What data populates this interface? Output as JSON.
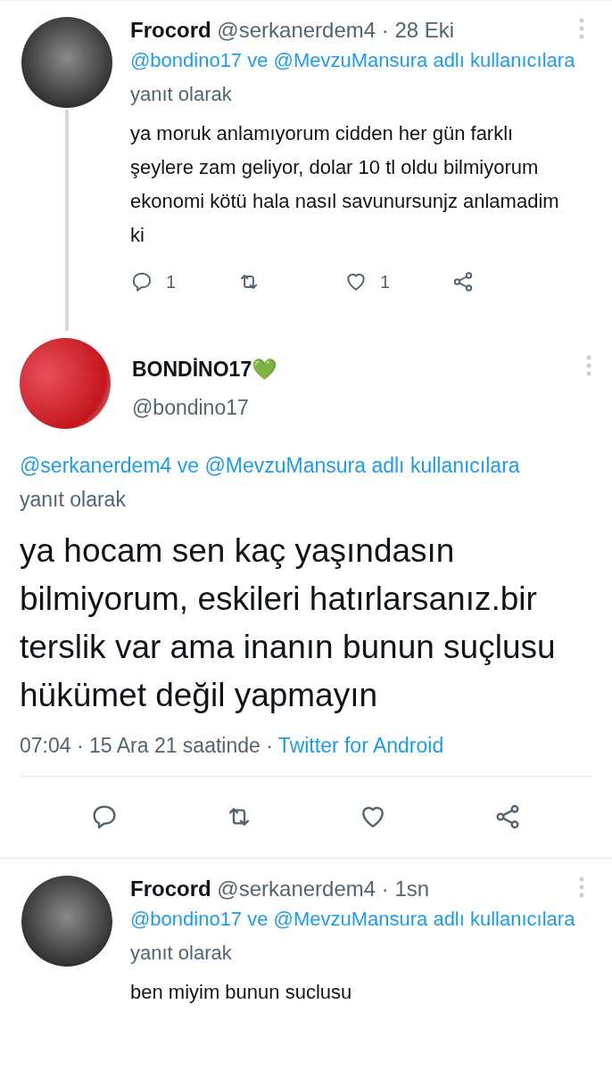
{
  "tweets": [
    {
      "kind": "reply",
      "name": "Frocord",
      "handle": "@serkanerdem4",
      "time": "· 28 Eki",
      "thread_line": true,
      "reply_mentions": "@bondino17 ve @MevzuMansura adlı kullanıcılara",
      "reply_suffix": "yanıt olarak",
      "text": "ya moruk anlamıyorum cidden her gün farklı şeylere zam geliyor, dolar 10 tl oldu bilmiyorum ekonomi kötü hala nasıl savunursunjz anlamadim ki",
      "actions": [
        {
          "kind": "reply",
          "count": "1"
        },
        {
          "kind": "retweet"
        },
        {
          "kind": "like",
          "count": "1"
        },
        {
          "kind": "share"
        }
      ]
    },
    {
      "kind": "main",
      "name": "BONDİNO17💚",
      "handle": "@bondino17",
      "reply_mentions": "@serkanerdem4 ve @MevzuMansura adlı kullanıcılara",
      "reply_suffix": "yanıt olarak",
      "text": "ya hocam sen kaç yaşındasın bilmiyorum, eskileri hatırlarsanız.bir terslik var ama inanın bunun suçlusu hükümet değil yapmayın",
      "meta": "07:04 · 15 Ara 21 saatinde ·",
      "source": "Twitter for Android",
      "actions": [
        {
          "kind": "reply"
        },
        {
          "kind": "retweet"
        },
        {
          "kind": "like"
        },
        {
          "kind": "share"
        }
      ]
    },
    {
      "kind": "reply",
      "name": "Frocord",
      "handle": "@serkanerdem4",
      "time": "· 1sn",
      "reply_mentions": "@bondino17 ve @MevzuMansura adlı kullanıcılara",
      "reply_suffix": "yanıt olarak",
      "text": "ben miyim bunun suclusu"
    }
  ]
}
